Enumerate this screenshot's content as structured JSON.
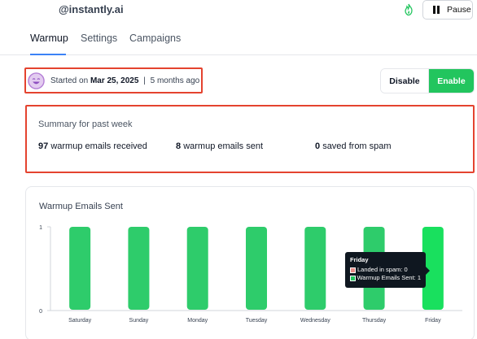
{
  "header": {
    "account": "@instantly.ai",
    "pause_label": "Pause"
  },
  "tabs": [
    {
      "label": "Warmup",
      "active": true
    },
    {
      "label": "Settings",
      "active": false
    },
    {
      "label": "Campaigns",
      "active": false
    }
  ],
  "status": {
    "prefix": "Started on",
    "date": "Mar 25, 2025",
    "separator": "|",
    "relative": "5 months ago"
  },
  "toggle": {
    "disable_label": "Disable",
    "enable_label": "Enable",
    "active": "Enable"
  },
  "summary": {
    "title": "Summary for past week",
    "received_count": "97",
    "received_label": "warmup emails received",
    "sent_count": "8",
    "sent_label": "warmup emails sent",
    "spam_count": "0",
    "spam_label": "saved from spam"
  },
  "chart_data": {
    "type": "bar",
    "title": "Warmup Emails Sent",
    "categories": [
      "Saturday",
      "Sunday",
      "Monday",
      "Tuesday",
      "Wednesday",
      "Thursday",
      "Friday"
    ],
    "series": [
      {
        "name": "Warmup Emails Sent",
        "values": [
          1,
          1,
          1,
          1,
          1,
          1,
          1
        ]
      }
    ],
    "ylim": [
      0,
      1
    ],
    "yticks": [
      "0",
      "1"
    ],
    "highlighted": "Friday",
    "grid": false
  },
  "tooltip": {
    "title": "Friday",
    "rows": [
      {
        "label": "Landed in spam: 0",
        "color": "#e98b87"
      },
      {
        "label": "Warmup Emails Sent: 1",
        "color": "#22c55e"
      }
    ]
  },
  "colors": {
    "accent": "#22c55e",
    "bar": "#2ecc6b",
    "bar_highlight": "#19e05e",
    "annotation": "#e4432f",
    "tab_underline": "#3b82f6"
  }
}
